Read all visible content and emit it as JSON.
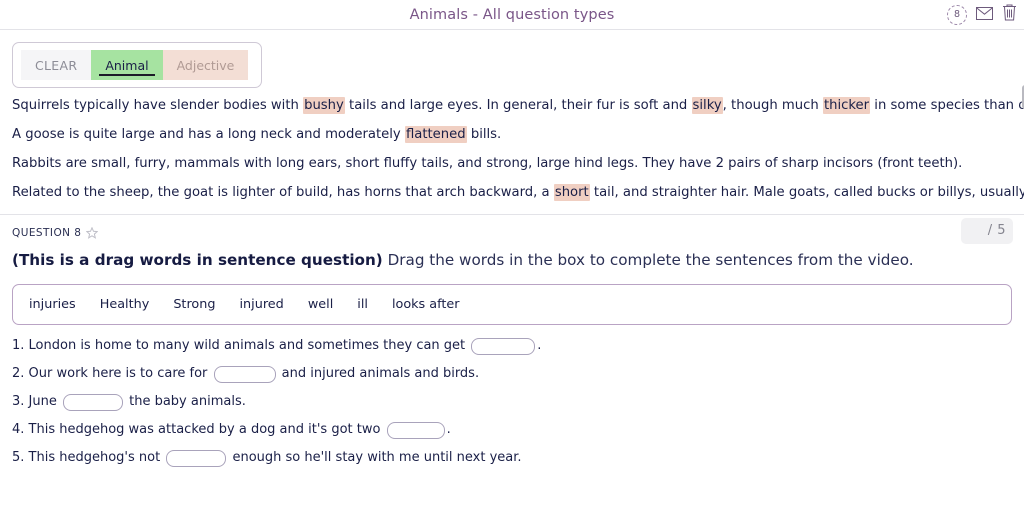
{
  "header": {
    "title": "Animals - All question types",
    "badge_count": "8",
    "icons": [
      "timer-badge-icon",
      "envelope-icon",
      "trash-icon"
    ]
  },
  "tagbar": {
    "clear_label": "CLEAR",
    "tags": [
      {
        "label": "Animal",
        "color": "#a6e3a1",
        "selected": true
      },
      {
        "label": "Adjective",
        "color": "#f3ded5",
        "selected": false
      }
    ]
  },
  "passage": {
    "lines": [
      [
        {
          "t": "Squirrels typically have slender bodies with ",
          "h": false
        },
        {
          "t": "bushy",
          "h": true
        },
        {
          "t": " tails and large eyes. In general, their fur is soft and ",
          "h": false
        },
        {
          "t": "silky",
          "h": true
        },
        {
          "t": ", though much ",
          "h": false
        },
        {
          "t": "thicker",
          "h": true
        },
        {
          "t": " in some species than others.",
          "h": false
        }
      ],
      [
        {
          "t": "A goose is quite large and has a long neck and moderately ",
          "h": false
        },
        {
          "t": "flattened",
          "h": true
        },
        {
          "t": " bills.",
          "h": false
        }
      ],
      [
        {
          "t": "Rabbits are small, furry, mammals with long ears, short fluffy tails, and strong, large hind legs. They have 2 pairs of sharp incisors (front teeth).",
          "h": false
        }
      ],
      [
        {
          "t": "Related to the sheep, the goat is lighter of build, has horns that arch backward, a ",
          "h": false
        },
        {
          "t": "short",
          "h": true
        },
        {
          "t": " tail, and straighter hair. Male goats, called bucks or billys, usually have a beard.",
          "h": false
        }
      ]
    ]
  },
  "question": {
    "label": "QUESTION 8",
    "star": "star-outline-icon",
    "score_value": "",
    "score_total": "/ 5",
    "prompt_bold": "(This is a drag words in sentence question)",
    "prompt_rest": " Drag the words in the box to complete the sentences from the video."
  },
  "wordbank": {
    "words": [
      "injuries",
      "Healthy",
      "Strong",
      "injured",
      "well",
      "ill",
      "looks after"
    ]
  },
  "sentences": [
    {
      "number": "1.",
      "before": " London is home to many wild animals and sometimes they can get ",
      "after": ".",
      "answer": ""
    },
    {
      "number": "2.",
      "before": " Our work here is to care for ",
      "after": " and injured animals and birds.",
      "answer": ""
    },
    {
      "number": "3.",
      "before": " June ",
      "after": " the baby animals.",
      "answer": ""
    },
    {
      "number": "4.",
      "before": " This hedgehog was attacked by a dog and it's got two ",
      "after": ".",
      "answer": ""
    },
    {
      "number": "5.",
      "before": " This hedgehog's not ",
      "after": " enough so he'll stay with me until next year.",
      "answer": ""
    }
  ],
  "colors": {
    "title": "#7a5688",
    "highlight": "#f0cfc2",
    "tag_animal": "#a6e3a1",
    "tag_adjective": "#f3ded5",
    "text": "#1a1f47",
    "wordbank_border": "#b9a3c4"
  }
}
